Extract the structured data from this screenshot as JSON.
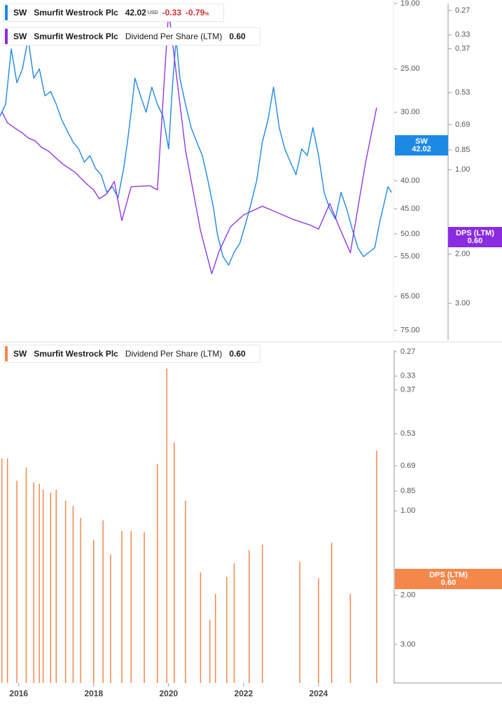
{
  "colors": {
    "price": "#1e88e5",
    "dps_line": "#8a2be2",
    "dps_bar": "#f4874b",
    "negative": "#d2322d",
    "axis": "#9a9aa0",
    "divider": "#dddddd"
  },
  "legend_price": {
    "ticker": "SW",
    "name": "Smurfit Westrock Plc",
    "price": "42.02",
    "currency": "USD",
    "change": "-0.33",
    "change_pct": "-0.79",
    "pct_sign": "%"
  },
  "legend_dps_top": {
    "ticker": "SW",
    "name": "Smurfit Westrock Plc",
    "metric": "Dividend Per Share (LTM)",
    "value": "0.60"
  },
  "legend_dps_bottom": {
    "ticker": "SW",
    "name": "Smurfit Westrock Plc",
    "metric": "Dividend Per Share (LTM)",
    "value": "0.60"
  },
  "tags": {
    "price_tag": {
      "label": "SW",
      "value": "42.02"
    },
    "dps_tag_top": {
      "label": "DPS (LTM)",
      "value": "0.60"
    },
    "dps_tag_bottom": {
      "label": "DPS (LTM)",
      "value": "0.60"
    }
  },
  "chart_data": [
    {
      "type": "line",
      "panel": "top",
      "title": "",
      "x_ticks": [
        "2016",
        "2018",
        "2020",
        "2022",
        "2024"
      ],
      "price_axis": {
        "scale": "log",
        "range": [
          19,
          78
        ],
        "ticks": [
          "75.00",
          "65.00",
          "55.00",
          "50.00",
          "45.00",
          "40.00",
          "35.00",
          "30.00",
          "25.00",
          "19.00"
        ]
      },
      "dps_axis": {
        "scale": "log",
        "range": [
          0.27,
          4.0
        ],
        "ticks": [
          "3.00",
          "2.00",
          "1.00",
          "0.85",
          "0.69",
          "0.53",
          "0.37",
          "0.33",
          "0.27"
        ]
      },
      "series": [
        {
          "name": "Smurfit Westrock Plc",
          "axis": "price",
          "points": [
            [
              2015.5,
              30.5
            ],
            [
              2015.65,
              29
            ],
            [
              2015.8,
              23
            ],
            [
              2015.95,
              26.5
            ],
            [
              2016.1,
              25
            ],
            [
              2016.25,
              22
            ],
            [
              2016.4,
              26
            ],
            [
              2016.55,
              25
            ],
            [
              2016.7,
              28
            ],
            [
              2016.85,
              27.5
            ],
            [
              2017.0,
              29
            ],
            [
              2017.15,
              31
            ],
            [
              2017.3,
              32.5
            ],
            [
              2017.45,
              34
            ],
            [
              2017.6,
              35
            ],
            [
              2017.75,
              37
            ],
            [
              2017.9,
              36
            ],
            [
              2018.05,
              38
            ],
            [
              2018.2,
              39
            ],
            [
              2018.35,
              42
            ],
            [
              2018.5,
              41
            ],
            [
              2018.65,
              43
            ],
            [
              2018.8,
              38
            ],
            [
              2018.9,
              34
            ],
            [
              2019.0,
              30
            ],
            [
              2019.1,
              26
            ],
            [
              2019.25,
              28
            ],
            [
              2019.4,
              30
            ],
            [
              2019.55,
              27
            ],
            [
              2019.7,
              29
            ],
            [
              2019.85,
              30.5
            ],
            [
              2020.0,
              35
            ],
            [
              2020.1,
              27
            ],
            [
              2020.2,
              22
            ],
            [
              2020.3,
              26
            ],
            [
              2020.45,
              29
            ],
            [
              2020.6,
              32
            ],
            [
              2020.75,
              34
            ],
            [
              2020.9,
              36
            ],
            [
              2021.05,
              40
            ],
            [
              2021.2,
              45
            ],
            [
              2021.3,
              50
            ],
            [
              2021.45,
              55
            ],
            [
              2021.6,
              57
            ],
            [
              2021.75,
              54
            ],
            [
              2021.9,
              52
            ],
            [
              2022.05,
              48
            ],
            [
              2022.2,
              44
            ],
            [
              2022.35,
              40
            ],
            [
              2022.5,
              34
            ],
            [
              2022.65,
              31
            ],
            [
              2022.8,
              27
            ],
            [
              2022.95,
              32
            ],
            [
              2023.1,
              35
            ],
            [
              2023.25,
              37
            ],
            [
              2023.4,
              39
            ],
            [
              2023.55,
              35
            ],
            [
              2023.7,
              36
            ],
            [
              2023.85,
              32
            ],
            [
              2024.0,
              36
            ],
            [
              2024.15,
              42
            ],
            [
              2024.3,
              45
            ],
            [
              2024.45,
              47
            ],
            [
              2024.6,
              42
            ],
            [
              2024.75,
              45
            ],
            [
              2024.9,
              49
            ],
            [
              2025.05,
              53
            ],
            [
              2025.2,
              55
            ],
            [
              2025.35,
              54
            ],
            [
              2025.5,
              53
            ],
            [
              2025.65,
              47
            ],
            [
              2025.75,
              44
            ],
            [
              2025.85,
              41
            ],
            [
              2025.95,
              42.02
            ]
          ]
        },
        {
          "name": "Dividend Per Share (LTM)",
          "axis": "dps",
          "points": [
            [
              2015.55,
              0.62
            ],
            [
              2015.7,
              0.68
            ],
            [
              2015.9,
              0.71
            ],
            [
              2016.1,
              0.74
            ],
            [
              2016.25,
              0.77
            ],
            [
              2016.45,
              0.79
            ],
            [
              2016.6,
              0.83
            ],
            [
              2016.8,
              0.86
            ],
            [
              2017.0,
              0.91
            ],
            [
              2017.2,
              0.96
            ],
            [
              2017.5,
              1.02
            ],
            [
              2017.8,
              1.12
            ],
            [
              2018.0,
              1.18
            ],
            [
              2018.15,
              1.27
            ],
            [
              2018.35,
              1.22
            ],
            [
              2018.55,
              1.1
            ],
            [
              2018.75,
              1.52
            ],
            [
              2019.0,
              1.15
            ],
            [
              2019.5,
              1.14
            ],
            [
              2019.7,
              1.18
            ],
            [
              2020.0,
              0.27
            ],
            [
              2020.45,
              0.85
            ],
            [
              2020.85,
              1.65
            ],
            [
              2021.15,
              2.35
            ],
            [
              2021.35,
              1.95
            ],
            [
              2021.65,
              1.6
            ],
            [
              2022.0,
              1.45
            ],
            [
              2022.5,
              1.35
            ],
            [
              2023.3,
              1.5
            ],
            [
              2023.8,
              1.58
            ],
            [
              2024.0,
              1.63
            ],
            [
              2024.3,
              1.32
            ],
            [
              2024.55,
              1.6
            ],
            [
              2024.85,
              1.98
            ],
            [
              2025.25,
              0.95
            ],
            [
              2025.55,
              0.6
            ]
          ]
        }
      ]
    },
    {
      "type": "bar",
      "panel": "bottom",
      "title": "",
      "x_ticks": [
        "2016",
        "2018",
        "2020",
        "2022",
        "2024"
      ],
      "y_axis": {
        "scale": "log",
        "range": [
          0.27,
          4.0
        ],
        "ticks": [
          "3.00",
          "2.00",
          "1.00",
          "0.85",
          "0.69",
          "0.53",
          "0.37",
          "0.33",
          "0.27"
        ]
      },
      "series": [
        {
          "name": "Dividend Per Share (LTM)",
          "bars": [
            [
              2015.55,
              0.65
            ],
            [
              2015.7,
              0.65
            ],
            [
              2015.95,
              0.78
            ],
            [
              2016.2,
              0.7
            ],
            [
              2016.4,
              0.79
            ],
            [
              2016.55,
              0.8
            ],
            [
              2016.65,
              0.84
            ],
            [
              2016.85,
              0.86
            ],
            [
              2017.0,
              0.84
            ],
            [
              2017.25,
              0.92
            ],
            [
              2017.45,
              0.96
            ],
            [
              2017.65,
              1.06
            ],
            [
              2018.0,
              1.27
            ],
            [
              2018.25,
              1.08
            ],
            [
              2018.45,
              1.43
            ],
            [
              2018.75,
              1.18
            ],
            [
              2019.0,
              1.18
            ],
            [
              2019.35,
              1.19
            ],
            [
              2019.7,
              0.68
            ],
            [
              2019.95,
              0.31
            ],
            [
              2020.15,
              0.57
            ],
            [
              2020.45,
              0.92
            ],
            [
              2020.85,
              1.66
            ],
            [
              2021.1,
              2.45
            ],
            [
              2021.25,
              1.98
            ],
            [
              2021.55,
              1.72
            ],
            [
              2021.75,
              1.54
            ],
            [
              2022.15,
              1.38
            ],
            [
              2022.5,
              1.32
            ],
            [
              2023.5,
              1.52
            ],
            [
              2024.0,
              1.74
            ],
            [
              2024.35,
              1.3
            ],
            [
              2024.85,
              1.98
            ],
            [
              2025.55,
              0.61
            ]
          ]
        }
      ]
    }
  ]
}
